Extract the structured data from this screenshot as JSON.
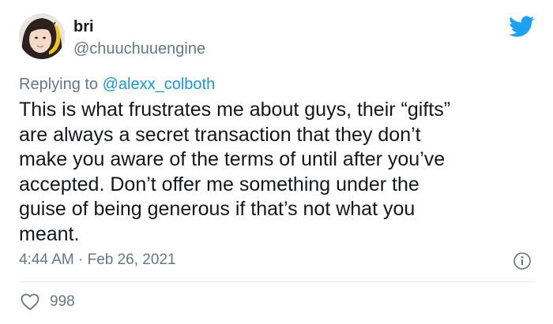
{
  "author": {
    "display_name": "bri",
    "handle": "@chuuchuuengine"
  },
  "reply": {
    "prefix": "Replying to",
    "mention": "@alexx_colboth"
  },
  "tweet": {
    "lines": [
      "This is what frustrates me about guys, their “gifts”",
      "are always a secret transaction that they don’t",
      "make you aware of the terms of until after you’ve",
      "accepted. Don’t offer me something under the",
      "guise of being generous if that’s not what you",
      "meant."
    ],
    "timestamp": "4:44 AM · Feb 26, 2021"
  },
  "stats": {
    "likes": "998"
  },
  "icons": {
    "brand": "twitter-bird-icon",
    "info": "info-icon",
    "like": "heart-icon"
  },
  "colors": {
    "brand_blue": "#1da1f2",
    "link_blue": "#1b95e0",
    "text": "#14171a",
    "secondary": "#657786",
    "divider": "#e6ecf0"
  }
}
